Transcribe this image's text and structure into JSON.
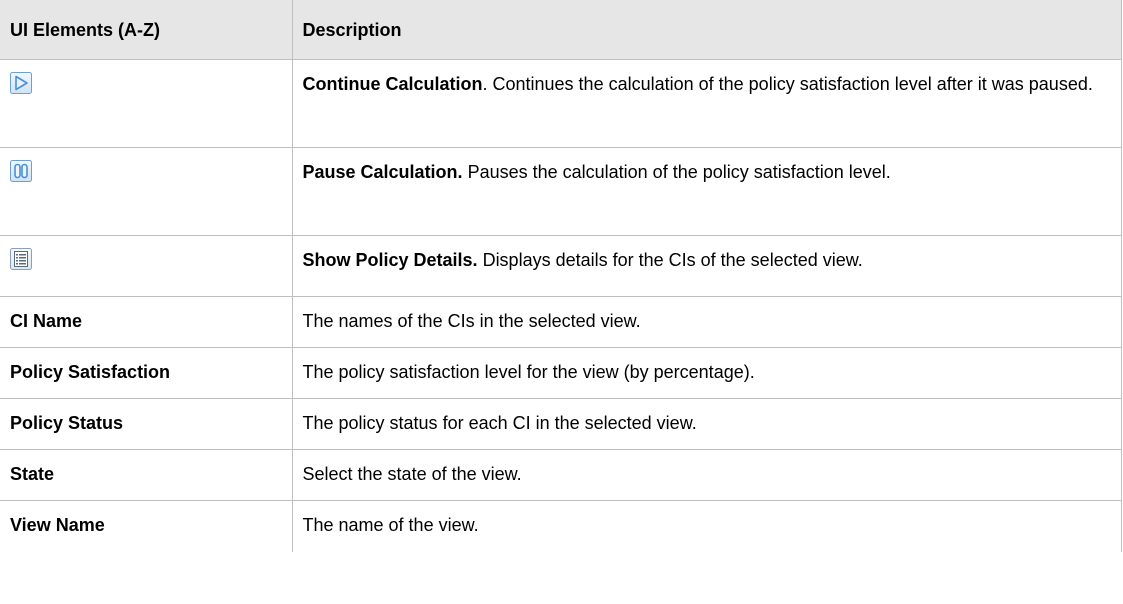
{
  "table": {
    "header": {
      "col1": "UI Elements (A-Z)",
      "col2": "Description"
    },
    "icon_rows": [
      {
        "icon": "continue-calculation-icon",
        "title": "Continue Calculation",
        "text": ". Continues the calculation of the policy satisfaction level after it was paused."
      },
      {
        "icon": "pause-calculation-icon",
        "title": "Pause Calculation.",
        "text": " Pauses the calculation of the policy satisfaction level."
      },
      {
        "icon": "show-policy-details-icon",
        "title": "Show Policy Details.",
        "text": " Displays details for the CIs of the selected view."
      }
    ],
    "rows": [
      {
        "element": "CI Name",
        "description": "The names of the CIs in the selected view."
      },
      {
        "element": "Policy Satisfaction",
        "description": "The policy satisfaction level for the view (by percentage)."
      },
      {
        "element": "Policy Status",
        "description": "The policy status for each CI in the selected view."
      },
      {
        "element": "State",
        "description": "Select the state of the view."
      },
      {
        "element": "View Name",
        "description": "The name of the view."
      }
    ]
  },
  "colors": {
    "header_bg": "#e6e6e6",
    "border": "#bfbfbf",
    "icon_frame": "#6f9fd2",
    "icon_fill": "#d8e8f8",
    "icon_accent": "#4a8fd8"
  }
}
